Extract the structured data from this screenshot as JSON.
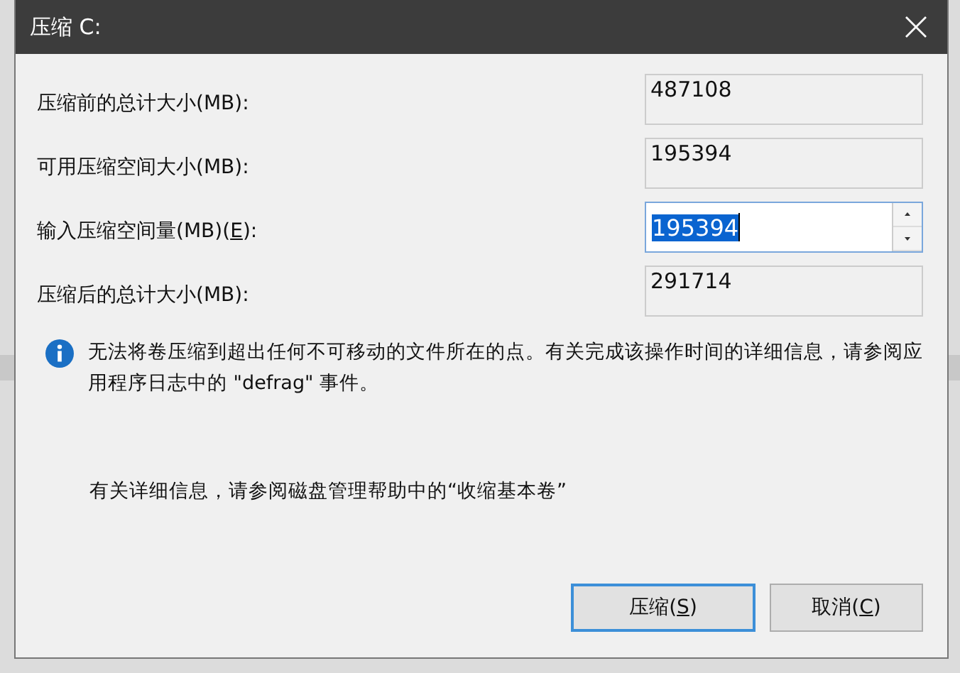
{
  "window": {
    "title": "压缩 C:"
  },
  "fields": [
    {
      "kind": "readonly",
      "label": {
        "pre": "压缩前的总计大小(MB):"
      },
      "value": "487108"
    },
    {
      "kind": "readonly",
      "label": {
        "pre": "可用压缩空间大小(MB):"
      },
      "value": "195394"
    },
    {
      "kind": "spin",
      "label": {
        "pre": "输入压缩空间量(MB)(",
        "key": "E",
        "post": "):"
      },
      "value": "195394",
      "selected": true
    },
    {
      "kind": "readonly",
      "label": {
        "pre": "压缩后的总计大小(MB):"
      },
      "value": "291714"
    }
  ],
  "info": {
    "message": "无法将卷压缩到超出任何不可移动的文件所在的点。有关完成该操作时间的详细信息，请参阅应用程序日志中的 \"defrag\" 事件。"
  },
  "help_text": "有关详细信息，请参阅磁盘管理帮助中的“收缩基本卷”",
  "buttons": [
    {
      "pre": "压缩(",
      "key": "S",
      "post": ")",
      "default": true
    },
    {
      "pre": "取消(",
      "key": "C",
      "post": ")",
      "default": false
    }
  ]
}
